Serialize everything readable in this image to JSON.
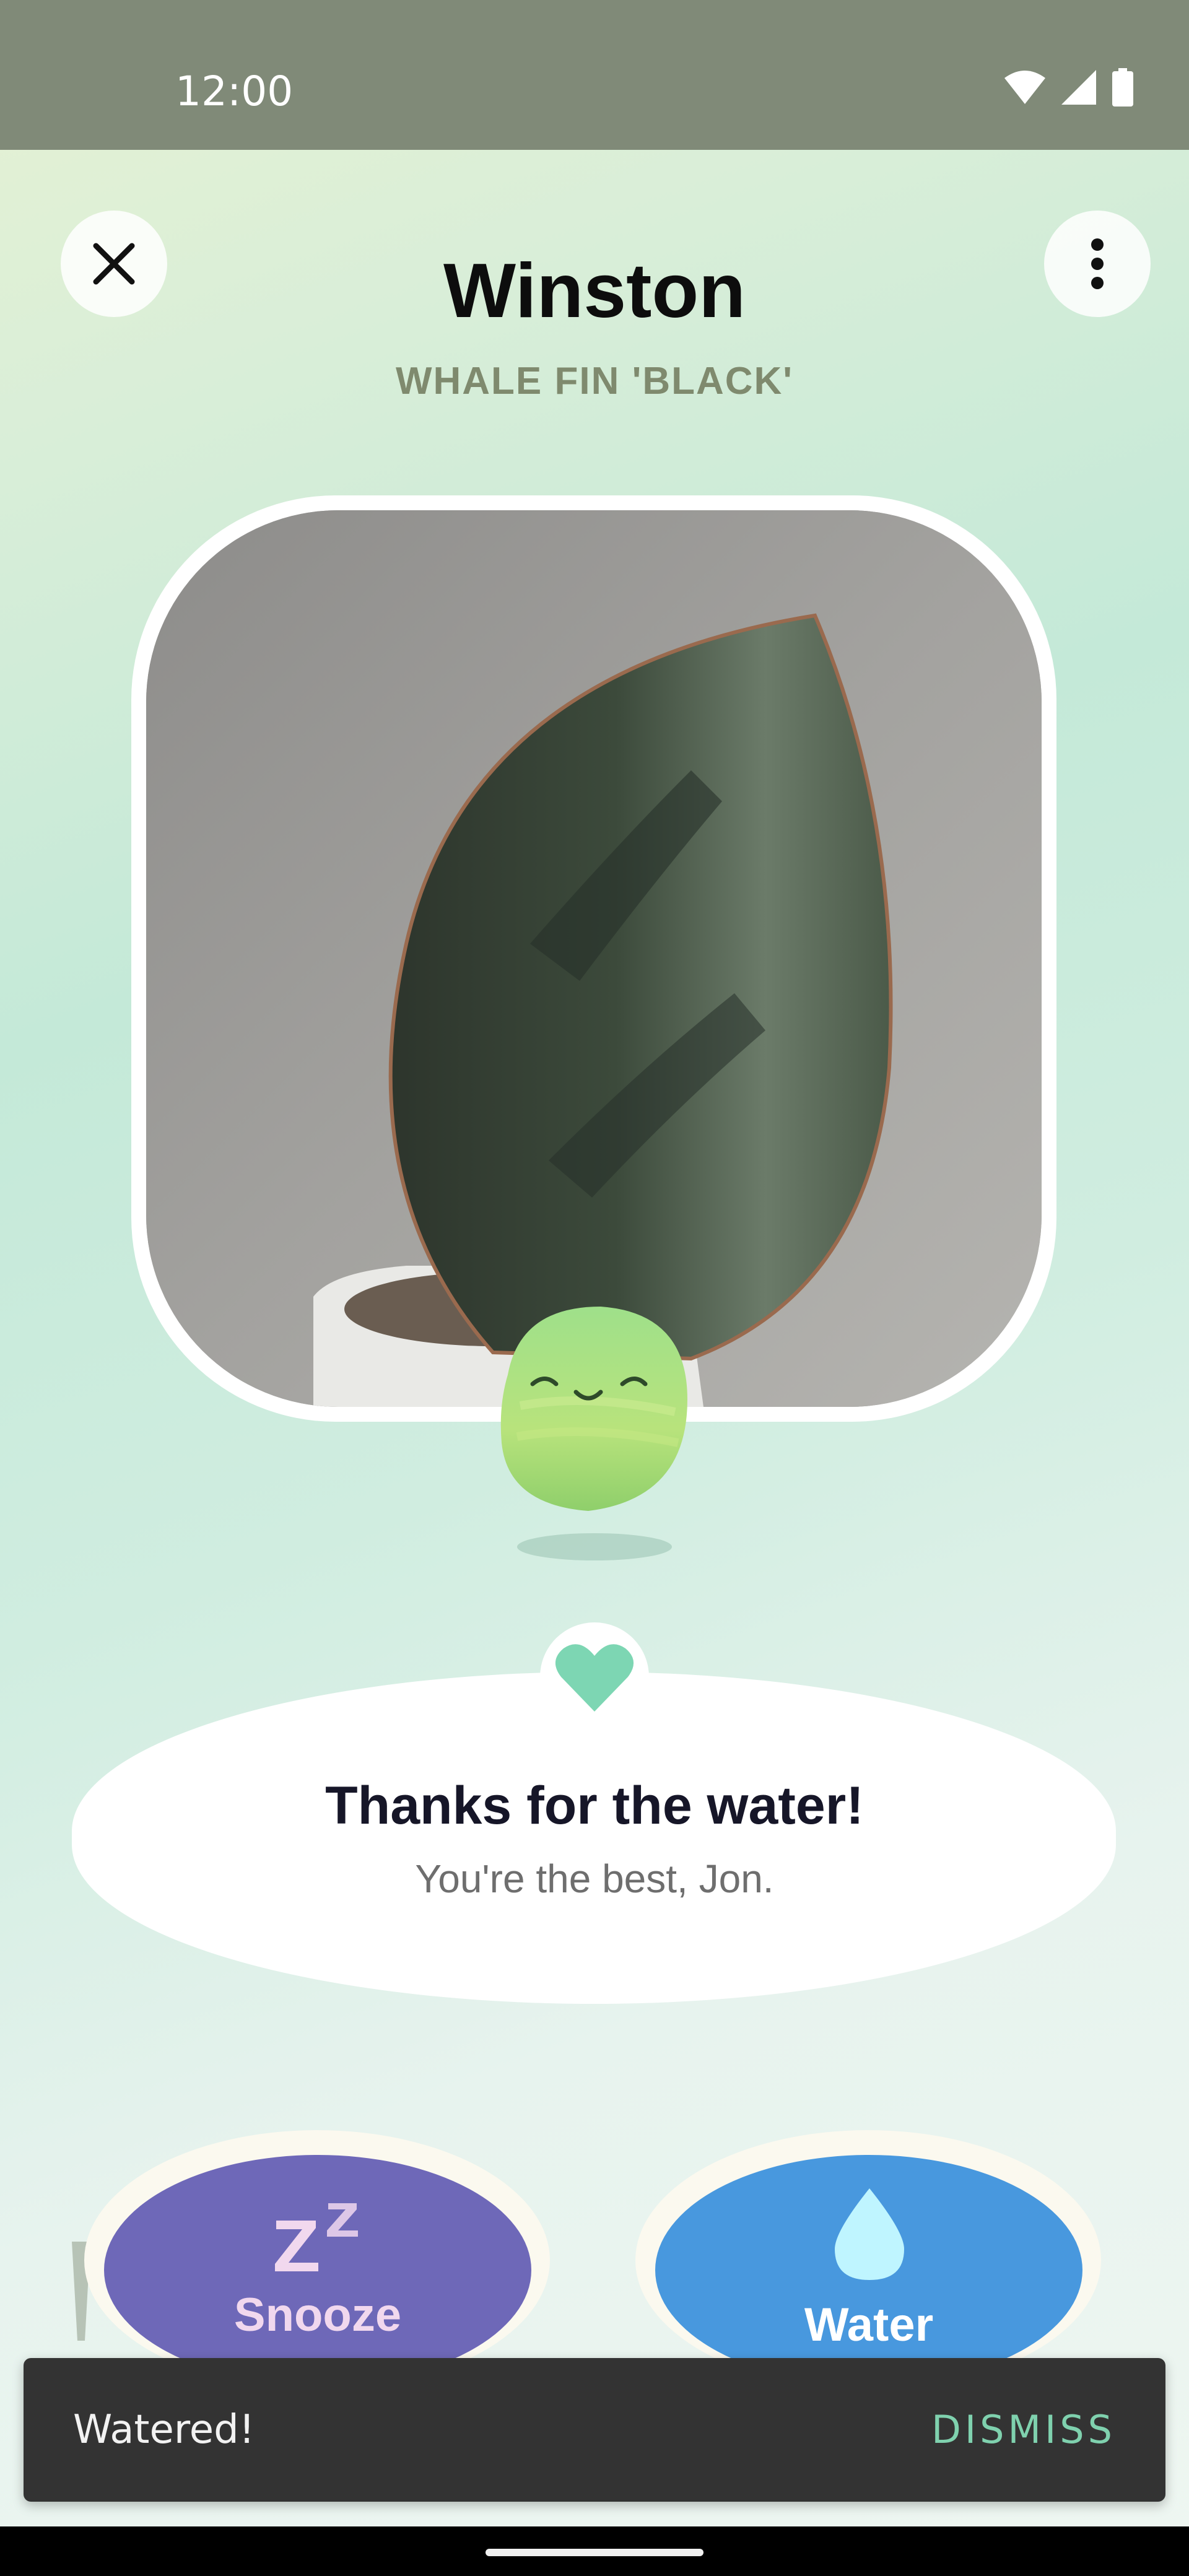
{
  "status_bar": {
    "time": "12:00",
    "icons": [
      "wifi-icon",
      "signal-icon",
      "battery-icon"
    ]
  },
  "header": {
    "close_icon": "close-icon",
    "more_icon": "more-vertical-icon",
    "plant_name": "Winston",
    "plant_species": "WHALE FIN 'BLACK'"
  },
  "photo": {
    "subject": "plant-leaf-photo"
  },
  "message": {
    "badge_icon": "heart-icon",
    "title": "Thanks for the water!",
    "subtitle": "You're the best, Jon."
  },
  "actions": {
    "snooze": {
      "label": "Snooze",
      "icon": "snooze-zz-icon",
      "color": "#6e68b8"
    },
    "water": {
      "label": "Water",
      "icon": "water-drop-icon",
      "color": "#4898de"
    }
  },
  "snackbar": {
    "text": "Watered!",
    "action": "DISMISS"
  },
  "colors": {
    "accent_green": "#7fd1ae",
    "heart": "#7dd6b3",
    "status_bar": "#808a78"
  }
}
